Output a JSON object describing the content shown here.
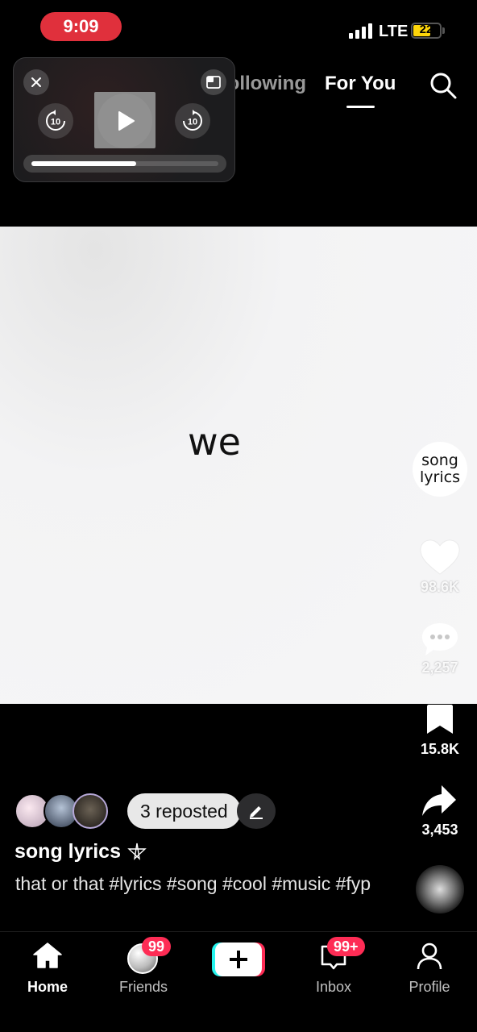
{
  "status_bar": {
    "time": "9:09",
    "network": "LTE",
    "battery": "22",
    "battery_level": 0.22
  },
  "top_nav": {
    "following_label": "Following",
    "for_you_label": "For You"
  },
  "pip_player": {
    "skip_back_label": "10",
    "skip_forward_label": "10",
    "progress": 0.56
  },
  "video": {
    "lyric_text": "we"
  },
  "right_rail": {
    "avatar_text": "song lyrics",
    "likes": "98.6K",
    "comments": "2,257",
    "saves": "15.8K",
    "shares": "3,453"
  },
  "caption": {
    "reposted_label": "3 reposted",
    "author": "song lyrics",
    "text": "that or that #lyrics #song #cool #music #fyp"
  },
  "bottom_nav": {
    "home": "Home",
    "friends": "Friends",
    "friends_badge": "99",
    "inbox": "Inbox",
    "inbox_badge": "99+",
    "profile": "Profile"
  },
  "colors": {
    "accent": "#fe2c55",
    "cyan": "#25f4ee",
    "time_pill": "#e0303c",
    "battery": "#ffd60a"
  }
}
